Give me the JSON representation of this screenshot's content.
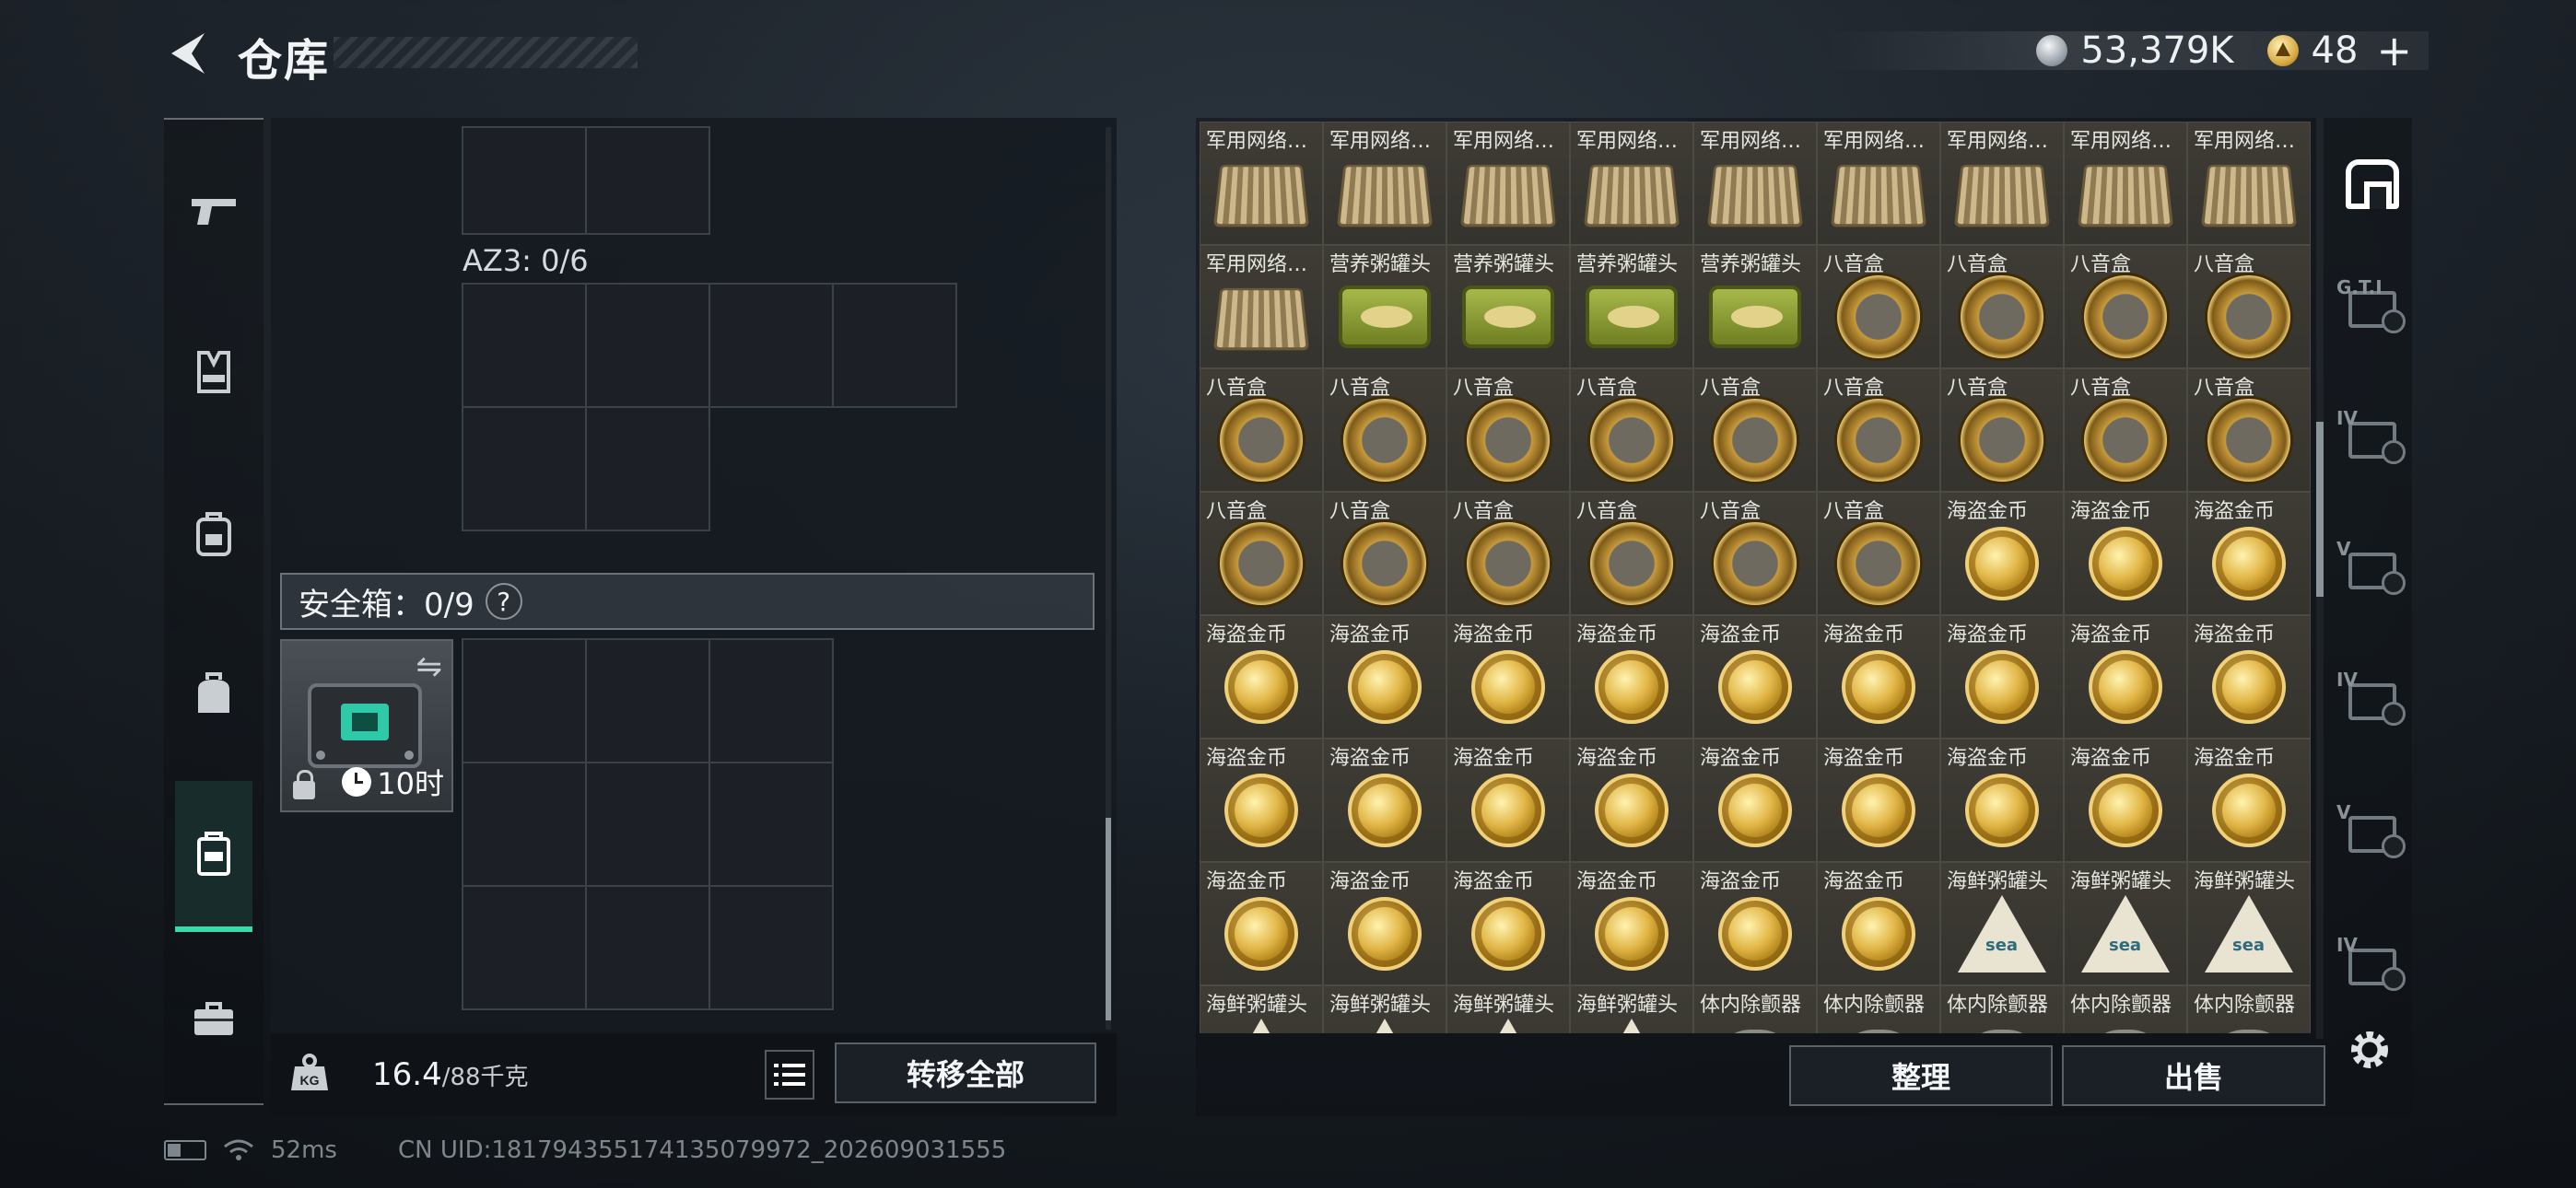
{
  "header": {
    "title": "仓库",
    "currency_silver": "53,379K",
    "currency_gold": "48",
    "plus_label": "+"
  },
  "left_panel": {
    "az3_label": "AZ3: 0/6",
    "safebox_label": "安全箱：0/9",
    "help_label": "?",
    "timer_label": "10时",
    "weight_value": "16.4",
    "weight_capacity": "/88千克",
    "transfer_all_label": "转移全部"
  },
  "right_panel": {
    "sort_label": "整理",
    "sell_label": "出售",
    "items": [
      {
        "name": "军用网络…",
        "art": "box"
      },
      {
        "name": "军用网络…",
        "art": "box"
      },
      {
        "name": "军用网络…",
        "art": "box"
      },
      {
        "name": "军用网络…",
        "art": "box"
      },
      {
        "name": "军用网络…",
        "art": "box"
      },
      {
        "name": "军用网络…",
        "art": "box"
      },
      {
        "name": "军用网络…",
        "art": "box"
      },
      {
        "name": "军用网络…",
        "art": "box"
      },
      {
        "name": "军用网络…",
        "art": "box"
      },
      {
        "name": "军用网络…",
        "art": "box"
      },
      {
        "name": "营养粥罐头",
        "art": "can"
      },
      {
        "name": "营养粥罐头",
        "art": "can"
      },
      {
        "name": "营养粥罐头",
        "art": "can"
      },
      {
        "name": "营养粥罐头",
        "art": "can"
      },
      {
        "name": "八音盒",
        "art": "music"
      },
      {
        "name": "八音盒",
        "art": "music"
      },
      {
        "name": "八音盒",
        "art": "music"
      },
      {
        "name": "八音盒",
        "art": "music"
      },
      {
        "name": "八音盒",
        "art": "music"
      },
      {
        "name": "八音盒",
        "art": "music"
      },
      {
        "name": "八音盒",
        "art": "music"
      },
      {
        "name": "八音盒",
        "art": "music"
      },
      {
        "name": "八音盒",
        "art": "music"
      },
      {
        "name": "八音盒",
        "art": "music"
      },
      {
        "name": "八音盒",
        "art": "music"
      },
      {
        "name": "八音盒",
        "art": "music"
      },
      {
        "name": "八音盒",
        "art": "music"
      },
      {
        "name": "八音盒",
        "art": "music"
      },
      {
        "name": "八音盒",
        "art": "music"
      },
      {
        "name": "八音盒",
        "art": "music"
      },
      {
        "name": "八音盒",
        "art": "music"
      },
      {
        "name": "八音盒",
        "art": "music"
      },
      {
        "name": "八音盒",
        "art": "music"
      },
      {
        "name": "海盗金币",
        "art": "coin"
      },
      {
        "name": "海盗金币",
        "art": "coin"
      },
      {
        "name": "海盗金币",
        "art": "coin"
      },
      {
        "name": "海盗金币",
        "art": "coin"
      },
      {
        "name": "海盗金币",
        "art": "coin"
      },
      {
        "name": "海盗金币",
        "art": "coin"
      },
      {
        "name": "海盗金币",
        "art": "coin"
      },
      {
        "name": "海盗金币",
        "art": "coin"
      },
      {
        "name": "海盗金币",
        "art": "coin"
      },
      {
        "name": "海盗金币",
        "art": "coin"
      },
      {
        "name": "海盗金币",
        "art": "coin"
      },
      {
        "name": "海盗金币",
        "art": "coin"
      },
      {
        "name": "海盗金币",
        "art": "coin"
      },
      {
        "name": "海盗金币",
        "art": "coin"
      },
      {
        "name": "海盗金币",
        "art": "coin"
      },
      {
        "name": "海盗金币",
        "art": "coin"
      },
      {
        "name": "海盗金币",
        "art": "coin"
      },
      {
        "name": "海盗金币",
        "art": "coin"
      },
      {
        "name": "海盗金币",
        "art": "coin"
      },
      {
        "name": "海盗金币",
        "art": "coin"
      },
      {
        "name": "海盗金币",
        "art": "coin"
      },
      {
        "name": "海盗金币",
        "art": "coin"
      },
      {
        "name": "海盗金币",
        "art": "coin"
      },
      {
        "name": "海盗金币",
        "art": "coin"
      },
      {
        "name": "海盗金币",
        "art": "coin"
      },
      {
        "name": "海盗金币",
        "art": "coin"
      },
      {
        "name": "海盗金币",
        "art": "coin"
      },
      {
        "name": "海鲜粥罐头",
        "art": "seafood"
      },
      {
        "name": "海鲜粥罐头",
        "art": "seafood"
      },
      {
        "name": "海鲜粥罐头",
        "art": "seafood"
      },
      {
        "name": "海鲜粥罐头",
        "art": "seafood"
      },
      {
        "name": "海鲜粥罐头",
        "art": "seafood"
      },
      {
        "name": "海鲜粥罐头",
        "art": "seafood"
      },
      {
        "name": "海鲜粥罐头",
        "art": "seafood"
      },
      {
        "name": "体内除颤器",
        "art": "grey"
      },
      {
        "name": "体内除颤器",
        "art": "grey"
      },
      {
        "name": "体内除颤器",
        "art": "grey"
      },
      {
        "name": "体内除颤器",
        "art": "grey"
      },
      {
        "name": "体内除颤器",
        "art": "grey"
      }
    ]
  },
  "container_rail": [
    {
      "icon": "home-container-icon",
      "level": "",
      "active": true
    },
    {
      "icon": "gti-case-icon",
      "level": "G.T.I",
      "active": false
    },
    {
      "icon": "case-iv-icon",
      "level": "IV",
      "active": false
    },
    {
      "icon": "case-v-icon",
      "level": "V",
      "active": false
    },
    {
      "icon": "case-iv-icon",
      "level": "IV",
      "active": false
    },
    {
      "icon": "case-v-icon",
      "level": "V",
      "active": false
    },
    {
      "icon": "case-iv-icon",
      "level": "IV",
      "active": false
    }
  ],
  "category_rail": [
    {
      "icon": "pistol-icon"
    },
    {
      "icon": "vest-icon"
    },
    {
      "icon": "backpack-icon"
    },
    {
      "icon": "bag-icon"
    },
    {
      "icon": "safebox-icon",
      "active": true
    },
    {
      "icon": "briefcase-icon"
    }
  ],
  "status": {
    "ping": "52ms",
    "uid": "CN UID:18179435517413507997​2_202609031555"
  }
}
